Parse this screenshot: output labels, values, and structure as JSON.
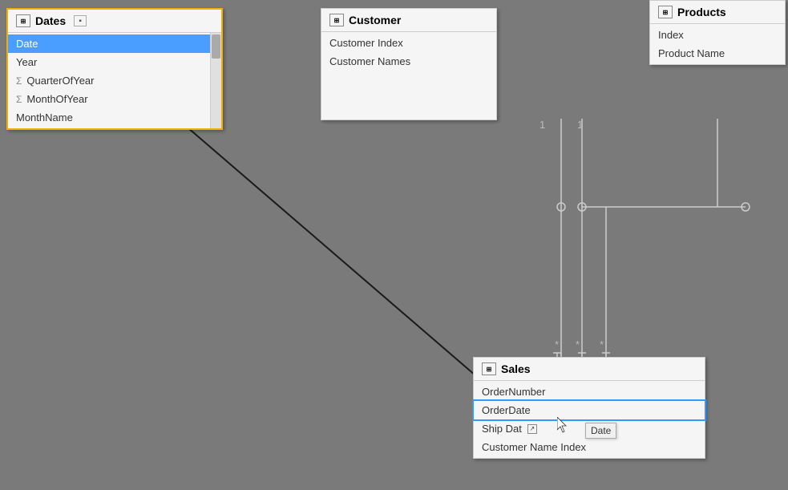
{
  "tables": {
    "dates": {
      "title": "Dates",
      "rows": [
        {
          "label": "Date",
          "type": "field",
          "selected": true
        },
        {
          "label": "Year",
          "type": "field",
          "selected": false
        },
        {
          "label": "QuarterOfYear",
          "type": "sigma",
          "selected": false
        },
        {
          "label": "MonthOfYear",
          "type": "sigma",
          "selected": false
        },
        {
          "label": "MonthName",
          "type": "field",
          "selected": false
        }
      ]
    },
    "customer": {
      "title": "Customer",
      "rows": [
        {
          "label": "Customer Index",
          "type": "field"
        },
        {
          "label": "Customer Names",
          "type": "field"
        }
      ]
    },
    "products": {
      "title": "Products",
      "rows": [
        {
          "label": "Index",
          "type": "field"
        },
        {
          "label": "Product Name",
          "type": "field"
        }
      ]
    },
    "sales": {
      "title": "Sales",
      "rows": [
        {
          "label": "OrderNumber",
          "type": "field"
        },
        {
          "label": "OrderDate",
          "type": "field",
          "highlighted": true
        },
        {
          "label": "Ship Date",
          "type": "field"
        },
        {
          "label": "Customer Name Index",
          "type": "field"
        }
      ]
    }
  },
  "relationship_labels": {
    "one_top": "1",
    "one_bottom": "1",
    "many_star1": "*",
    "many_star2": "*",
    "many_star3": "*"
  },
  "tooltip": {
    "text": "Date",
    "icon": "↗"
  }
}
